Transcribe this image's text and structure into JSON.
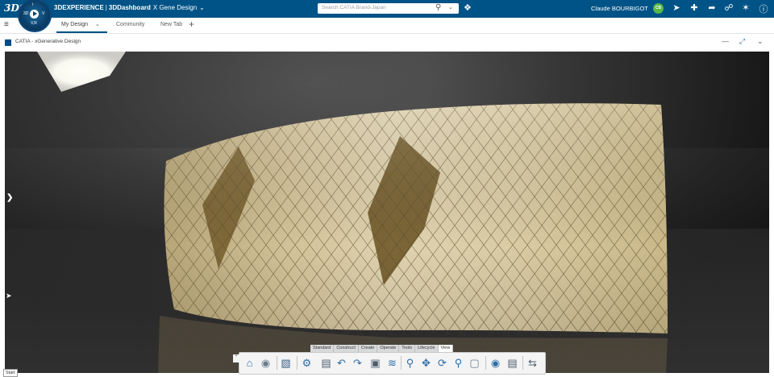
{
  "topbar": {
    "logo_text": "3DS",
    "compass": {
      "q1": "3D",
      "q2": "V",
      "q3": "V,R",
      "q4": "i"
    },
    "brand": "3DEXPERIENCE",
    "separator": "|",
    "app": "3DDashboard",
    "dashboard": "X Gene Design",
    "search_placeholder": "Search CATIA Brand-Japan",
    "user_name": "Claude BOURBIGOT",
    "user_initials": "CB"
  },
  "tabs": [
    {
      "label": "My Design",
      "active": true
    },
    {
      "label": "Community",
      "active": false
    },
    {
      "label": "New Tab",
      "active": false
    }
  ],
  "widget": {
    "title": "CATIA - xGenerative Design"
  },
  "action_bar": {
    "tabs": [
      "Standard",
      "Construct",
      "Create",
      "Operate",
      "Tools",
      "Lifecycle",
      "View"
    ],
    "selected_tab": "View"
  },
  "tooltip": "Start",
  "colors": {
    "brand_blue": "#005386",
    "surface": "#c8b68a",
    "avatar": "#57b847"
  }
}
